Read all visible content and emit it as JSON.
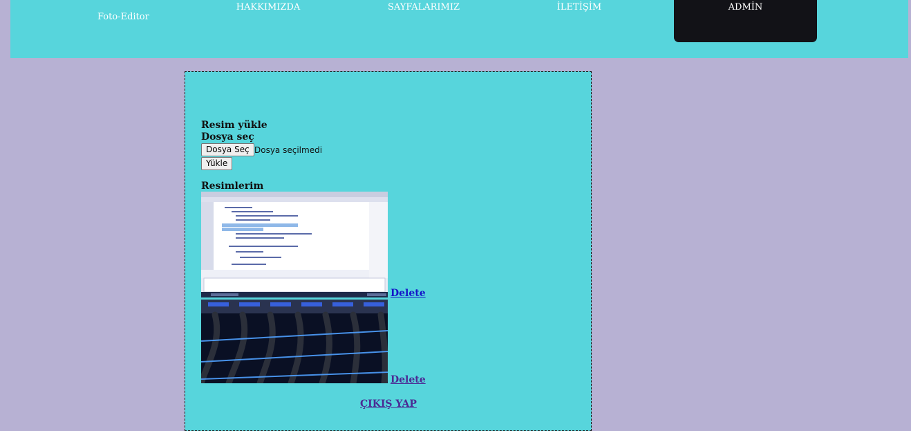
{
  "nav": {
    "brand": "Foto-Editor",
    "items": [
      "HAKKIMIZDA",
      "SAYFALARIMIZ",
      "İLETİŞİM"
    ],
    "admin": "ADMİN"
  },
  "upload": {
    "title": "Resim yükle",
    "file_label": "Dosya seç",
    "choose_button": "Dosya Seç",
    "file_status": "Dosya seçilmedi",
    "upload_button": "Yükle"
  },
  "gallery": {
    "title": "Resimlerim",
    "images": [
      {
        "icon": "code-editor-screenshot",
        "delete_label": "Delete"
      },
      {
        "icon": "network-cables-photo",
        "delete_label": "Delete"
      }
    ]
  },
  "logout_label": "ÇIKIŞ YAP",
  "colors": {
    "page_bg": "#b7b1d3",
    "bar_bg": "#57d5dc",
    "admin_bg": "#121217",
    "link_blue": "#1414c8",
    "link_visited": "#4b2a94"
  }
}
